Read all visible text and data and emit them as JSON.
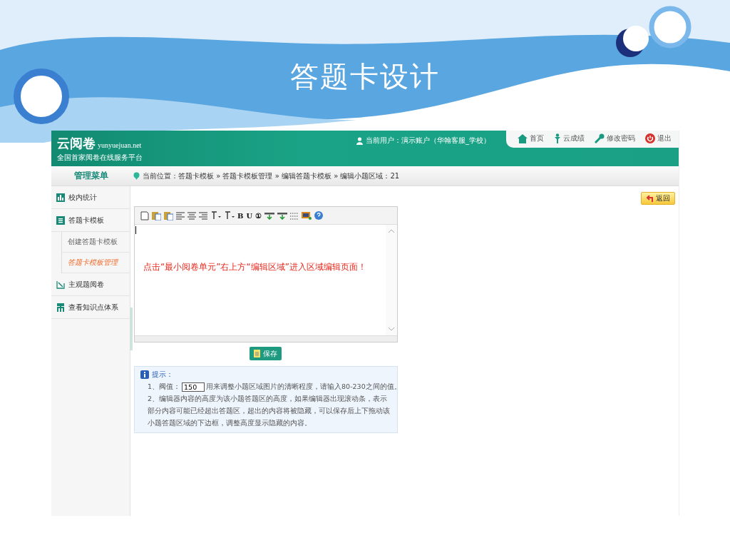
{
  "slide": {
    "title": "答题卡设计"
  },
  "app": {
    "logo": {
      "name": "云阅卷",
      "domain": "yunyuejuan.net",
      "tagline": "全国首家阅卷在线服务平台"
    },
    "user": "当前用户：演示账户（华翰客服_学校）",
    "nav": [
      {
        "kind": "home",
        "label": "首页"
      },
      {
        "kind": "person",
        "label": "云成绩"
      },
      {
        "kind": "key",
        "label": "修改密码"
      },
      {
        "kind": "power",
        "label": "退出"
      }
    ],
    "menu_title": "管理菜单",
    "breadcrumb": "当前位置：答题卡模板 » 答题卡模板管理 » 编辑答题卡模板 » 编辑小题区域：21",
    "sidebar": [
      {
        "kind": "chart",
        "label": "校内统计",
        "selected": false
      },
      {
        "kind": "list",
        "label": "答题卡模板",
        "selected": false,
        "children": [
          {
            "label": "创建答题卡模板",
            "selected": false
          },
          {
            "label": "答题卡模板管理",
            "selected": true
          }
        ]
      },
      {
        "kind": "pen",
        "label": "主观题阅卷",
        "selected": false
      },
      {
        "kind": "tree",
        "label": "查看知识点体系",
        "selected": false
      }
    ],
    "back_button": "返回",
    "toolbar": [
      {
        "kind": "page"
      },
      {
        "kind": "word"
      },
      {
        "kind": "paste"
      },
      {
        "kind": "align-left"
      },
      {
        "kind": "align-center"
      },
      {
        "kind": "align-right"
      },
      {
        "kind": "font"
      },
      {
        "kind": "size"
      },
      {
        "kind": "text",
        "label": "B"
      },
      {
        "kind": "text",
        "label": "U"
      },
      {
        "kind": "text",
        "label": "①"
      },
      {
        "kind": "insert"
      },
      {
        "kind": "insert"
      },
      {
        "kind": "grid"
      },
      {
        "kind": "image"
      },
      {
        "kind": "help"
      }
    ],
    "editor_text": "点击“最小阅卷单元”右上方“编辑区域”进入区域编辑页面！",
    "save_button": "保存",
    "tips": {
      "title": "提示：",
      "threshold_label": "1、阀值：",
      "threshold_value": "150",
      "threshold_note": "用来调整小题区域图片的清晰程度，请输入80-230之间的值。",
      "note": "2、编辑器内容的高度为该小题答题区的高度，如果编辑器出现滚动条，表示部分内容可能已经超出答题区，超出的内容将被隐藏，可以保存后上下拖动该小题答题区域的下边框，调整高度显示隐藏的内容。"
    }
  }
}
